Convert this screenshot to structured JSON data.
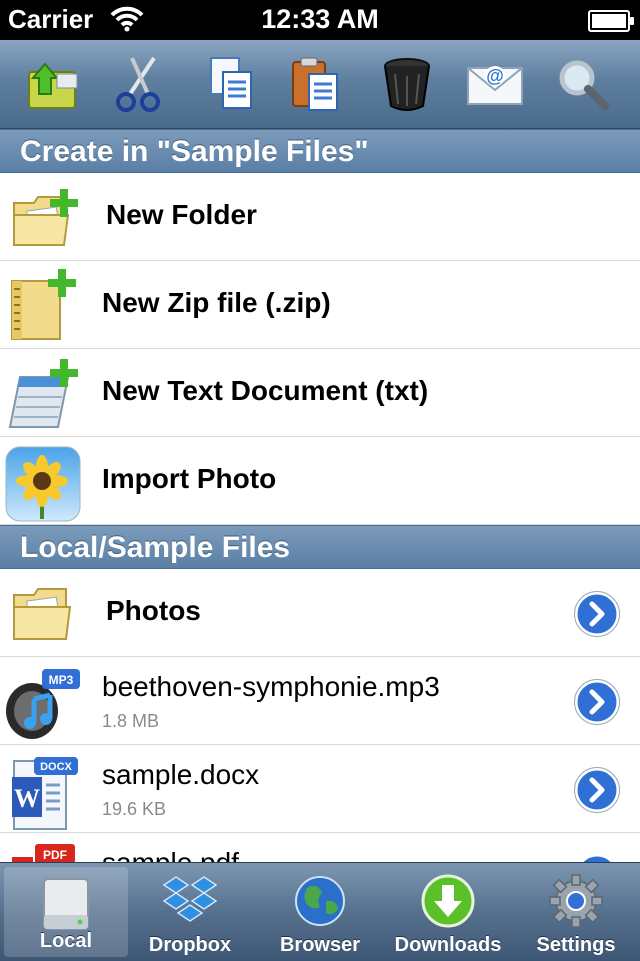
{
  "status_bar": {
    "carrier": "Carrier",
    "time": "12:33 AM"
  },
  "toolbar": {
    "buttons": [
      {
        "name": "upload-folder-icon"
      },
      {
        "name": "scissors-icon"
      },
      {
        "name": "copy-icon"
      },
      {
        "name": "paste-icon"
      },
      {
        "name": "trash-icon"
      },
      {
        "name": "mail-icon"
      },
      {
        "name": "search-icon"
      }
    ]
  },
  "create_section": {
    "header": "Create in \"Sample Files\"",
    "items": [
      {
        "label": "New Folder",
        "icon": "new-folder-icon"
      },
      {
        "label": "New Zip file (.zip)",
        "icon": "new-zip-icon"
      },
      {
        "label": "New Text Document (txt)",
        "icon": "new-text-document-icon"
      },
      {
        "label": "Import Photo",
        "icon": "photo-icon"
      }
    ]
  },
  "files_section": {
    "header": "Local/Sample Files",
    "items": [
      {
        "label": "Photos",
        "size": "",
        "badge": ""
      },
      {
        "label": "beethoven-symphonie.mp3",
        "size": "1.8 MB",
        "badge": "MP3"
      },
      {
        "label": "sample.docx",
        "size": "19.6 KB",
        "badge": "DOCX"
      },
      {
        "label": "sample.pdf",
        "size": "",
        "badge": "PDF"
      }
    ]
  },
  "tab_bar": {
    "tabs": [
      {
        "label": "Local",
        "active": true
      },
      {
        "label": "Dropbox"
      },
      {
        "label": "Browser"
      },
      {
        "label": "Downloads"
      },
      {
        "label": "Settings"
      }
    ]
  }
}
